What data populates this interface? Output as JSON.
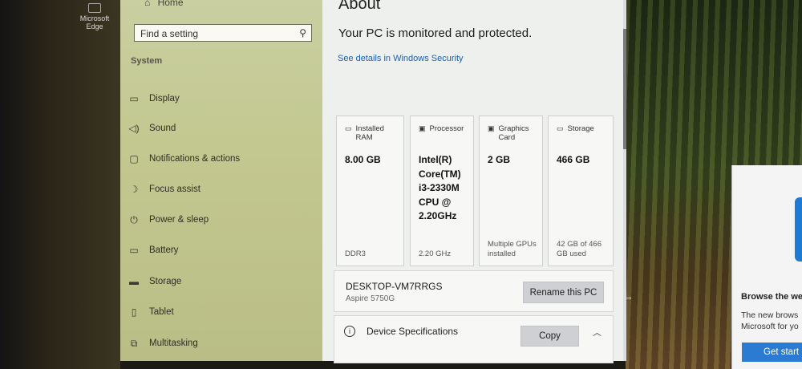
{
  "desktop": {
    "edge_icon_label": "Microsoft Edge"
  },
  "nav": {
    "home": "Home",
    "search_placeholder": "Find a setting",
    "section": "System",
    "items": [
      {
        "label": "Display",
        "icon": "display-icon"
      },
      {
        "label": "Sound",
        "icon": "speaker-icon"
      },
      {
        "label": "Notifications & actions",
        "icon": "notification-icon"
      },
      {
        "label": "Focus assist",
        "icon": "moon-icon"
      },
      {
        "label": "Power & sleep",
        "icon": "power-icon"
      },
      {
        "label": "Battery",
        "icon": "battery-icon"
      },
      {
        "label": "Storage",
        "icon": "storage-icon"
      },
      {
        "label": "Tablet",
        "icon": "tablet-icon"
      },
      {
        "label": "Multitasking",
        "icon": "multitasking-icon"
      }
    ]
  },
  "content": {
    "title": "About",
    "protection": "Your PC is monitored and protected.",
    "security_link": "See details in Windows Security",
    "cards": [
      {
        "header": "Installed RAM",
        "value": "8.00 GB",
        "footer": "DDR3",
        "icon": "ram-icon"
      },
      {
        "header": "Processor",
        "value": "Intel(R) Core(TM) i3-2330M CPU @ 2.20GHz",
        "footer": "2.20 GHz",
        "icon": "processor-icon"
      },
      {
        "header": "Graphics Card",
        "value": "2 GB",
        "footer": "Multiple GPUs installed",
        "icon": "graphics-icon"
      },
      {
        "header": "Storage",
        "value": "466 GB",
        "footer": "42 GB of 466 GB used",
        "icon": "storage-icon"
      }
    ],
    "pc_name": "DESKTOP-VM7RRGS",
    "pc_model": "Aspire 5750G",
    "rename_button": "Rename this PC",
    "device_specs": "Device Specifications",
    "copy_button": "Copy"
  },
  "popup": {
    "title": "Browse the wel",
    "desc_line1": "The new brows",
    "desc_line2": "Microsoft for yo",
    "cta": "Get start"
  }
}
